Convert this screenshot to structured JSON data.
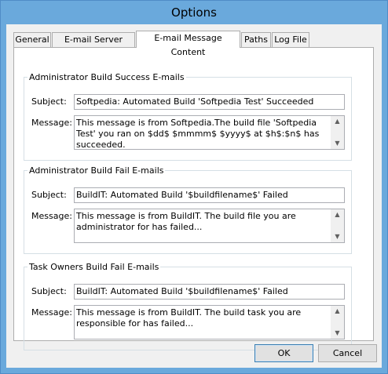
{
  "window": {
    "title": "Options"
  },
  "tabs": [
    {
      "label": "General"
    },
    {
      "label": "E-mail Server Setup"
    },
    {
      "label": "E-mail Message Content"
    },
    {
      "label": "Paths"
    },
    {
      "label": "Log File"
    }
  ],
  "groups": {
    "success": {
      "legend": "Administrator Build Success E-mails",
      "subject_label": "Subject:",
      "subject_value": "Softpedia: Automated Build 'Softpedia Test' Succeeded",
      "message_label": "Message:",
      "message_value": "This message is from Softpedia.The build file 'Softpedia Test' you ran on $dd$ $mmmm$ $yyyy$ at $h$:$n$ has succeeded."
    },
    "fail": {
      "legend": "Administrator Build Fail E-mails",
      "subject_label": "Subject:",
      "subject_value": "BuildIT: Automated Build '$buildfilename$' Failed",
      "message_label": "Message:",
      "message_value": "This message is from BuildIT. The build file you are administrator for has failed..."
    },
    "task": {
      "legend": "Task Owners Build Fail E-mails",
      "subject_label": "Subject:",
      "subject_value": "BuildIT: Automated Build '$buildfilename$' Failed",
      "message_label": "Message:",
      "message_value": "This message is from BuildIT. The build task you are responsible for has failed..."
    }
  },
  "buttons": {
    "ok": "OK",
    "cancel": "Cancel"
  }
}
